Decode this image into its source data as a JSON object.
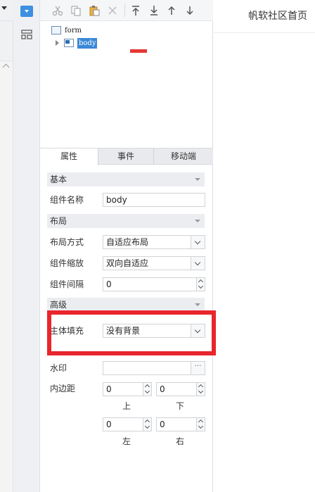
{
  "tree": {
    "form_label": "form",
    "body_label": "body"
  },
  "tabs": [
    "属性",
    "事件",
    "移动端"
  ],
  "sections": {
    "basic": "基本",
    "layout": "布局",
    "advanced": "高级"
  },
  "props": {
    "component_name_label": "组件名称",
    "component_name_value": "body",
    "layout_mode_label": "布局方式",
    "layout_mode_value": "自适应布局",
    "component_scale_label": "组件缩放",
    "component_scale_value": "双向自适应",
    "component_gap_label": "组件间隔",
    "component_gap_value": "0",
    "body_fill_label": "主体填充",
    "body_fill_value": "没有背景",
    "watermark_label": "水印",
    "watermark_value": "",
    "watermark_btn": "···",
    "padding_label": "内边距",
    "padding_top": "0",
    "padding_bottom": "0",
    "padding_left": "0",
    "padding_right": "0",
    "top_label": "上",
    "bottom_label": "下",
    "left_label": "左",
    "right_label": "右"
  },
  "header": {
    "title": "帆软社区首页"
  },
  "icons": {
    "toolbar": [
      "cut-icon",
      "copy-icon",
      "paste-icon",
      "delete-icon",
      "move-top-icon",
      "move-bottom-icon",
      "move-up-icon",
      "move-down-icon"
    ]
  },
  "colors": {
    "highlight": "#e8262b",
    "selection": "#3b88d6",
    "accent_blue": "#3d8fe0"
  }
}
